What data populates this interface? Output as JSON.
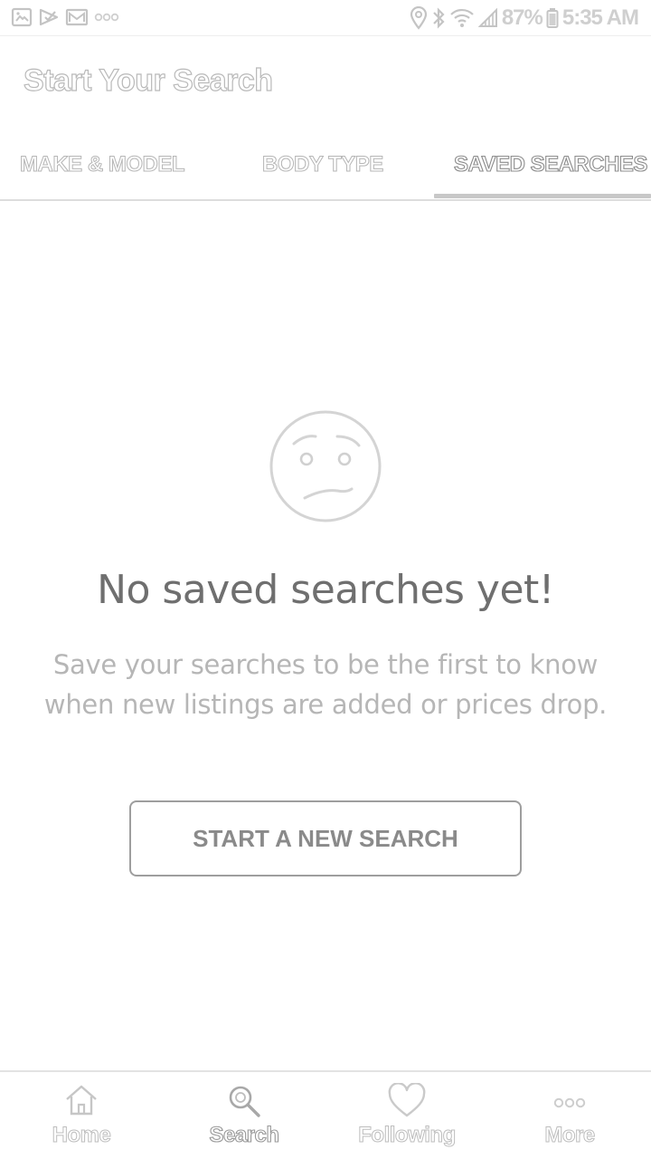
{
  "status_bar": {
    "left_icons": [
      "gallery-icon",
      "check-icon",
      "mail-icon",
      "more-dots-icon"
    ],
    "right_icons": [
      "location-icon",
      "bluetooth-icon",
      "wifi-icon",
      "signal-icon",
      "battery-icon"
    ],
    "battery": "87%",
    "time": "5:35 AM"
  },
  "header": {
    "title": "Start Your Search"
  },
  "tabs": [
    {
      "label": "MAKE & MODEL",
      "selected": false
    },
    {
      "label": "BODY TYPE",
      "selected": false
    },
    {
      "label": "SAVED SEARCHES",
      "selected": true
    }
  ],
  "empty_state": {
    "icon": "confused-face-icon",
    "title": "No saved searches yet!",
    "description_line1": "Save your searches to be the first to know",
    "description_line2": "when new listings are added or prices drop.",
    "button_label": "START A NEW SEARCH"
  },
  "bottom_nav": {
    "items": [
      {
        "label": "Home",
        "icon": "home-icon",
        "active": false
      },
      {
        "label": "Search",
        "icon": "search-icon",
        "active": true
      },
      {
        "label": "Following",
        "icon": "heart-icon",
        "active": false
      },
      {
        "label": "More",
        "icon": "more-dots-icon",
        "active": false
      }
    ]
  },
  "colors": {
    "text_primary": "#6f6f6f",
    "text_secondary": "#b6b6b6",
    "outline": "#9e9e9e",
    "divider": "#dddddd"
  }
}
